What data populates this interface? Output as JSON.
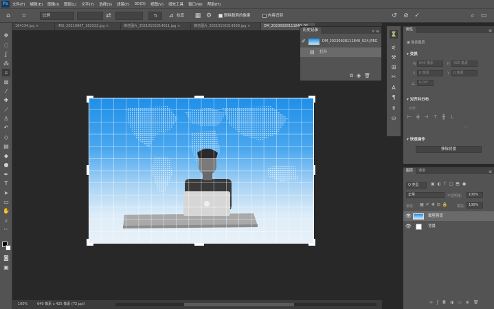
{
  "menubar": {
    "logo": "Ps",
    "items": [
      "文件(F)",
      "编辑(E)",
      "图像(I)",
      "图层(L)",
      "文字(Y)",
      "选择(S)",
      "滤镜(T)",
      "3D(D)",
      "视图(V)",
      "增效工具",
      "窗口(W)",
      "帮助(H)"
    ]
  },
  "options": {
    "ratio_select": "比例",
    "straighten_label": "拉直",
    "delete_cropped_label": "删除裁剪的像素",
    "content_aware_label": "内容识别"
  },
  "tabs": [
    "164134.jpg",
    "IMG_20210607_162322.jpg",
    "微信图片_20210102214011.jpg",
    "微信图片_20210102214338.jpg",
    "DM_20230928111840_02"
  ],
  "history": {
    "title": "历史记录",
    "snapshot": "DM_20230928111840_024.JPEG",
    "step": "打开"
  },
  "properties": {
    "tab": "属性",
    "doc_label": "像素图层",
    "transform_title": "变换",
    "w_label": "W",
    "h_label": "H",
    "x_label": "X",
    "y_label": "Y",
    "w_value": "640 像素",
    "h_value": "425 像素",
    "x_value": "0 像素",
    "y_value": "0 像素",
    "angle_value": "0.00°",
    "align_title": "对齐并分布",
    "align_sub": "对齐:",
    "quick_title": "快速操作",
    "remove_bg": "移除背景"
  },
  "layers_panel": {
    "tabs": [
      "图层",
      "通道"
    ],
    "filter_label": "Q 类型",
    "blend_mode": "正常",
    "opacity_label": "不透明度:",
    "opacity_value": "100%",
    "lock_label": "锁定:",
    "fill_label": "填充:",
    "fill_value": "100%",
    "layers": [
      {
        "name": "裁剪预览"
      },
      {
        "name": "背景"
      }
    ]
  },
  "status": {
    "zoom": "100%",
    "doc_info": "640 像素 x 425 像素 (72 ppi)"
  },
  "colors": {
    "ui_bg": "#535353",
    "canvas_bg": "#282828",
    "accent": "#31a8ff"
  }
}
